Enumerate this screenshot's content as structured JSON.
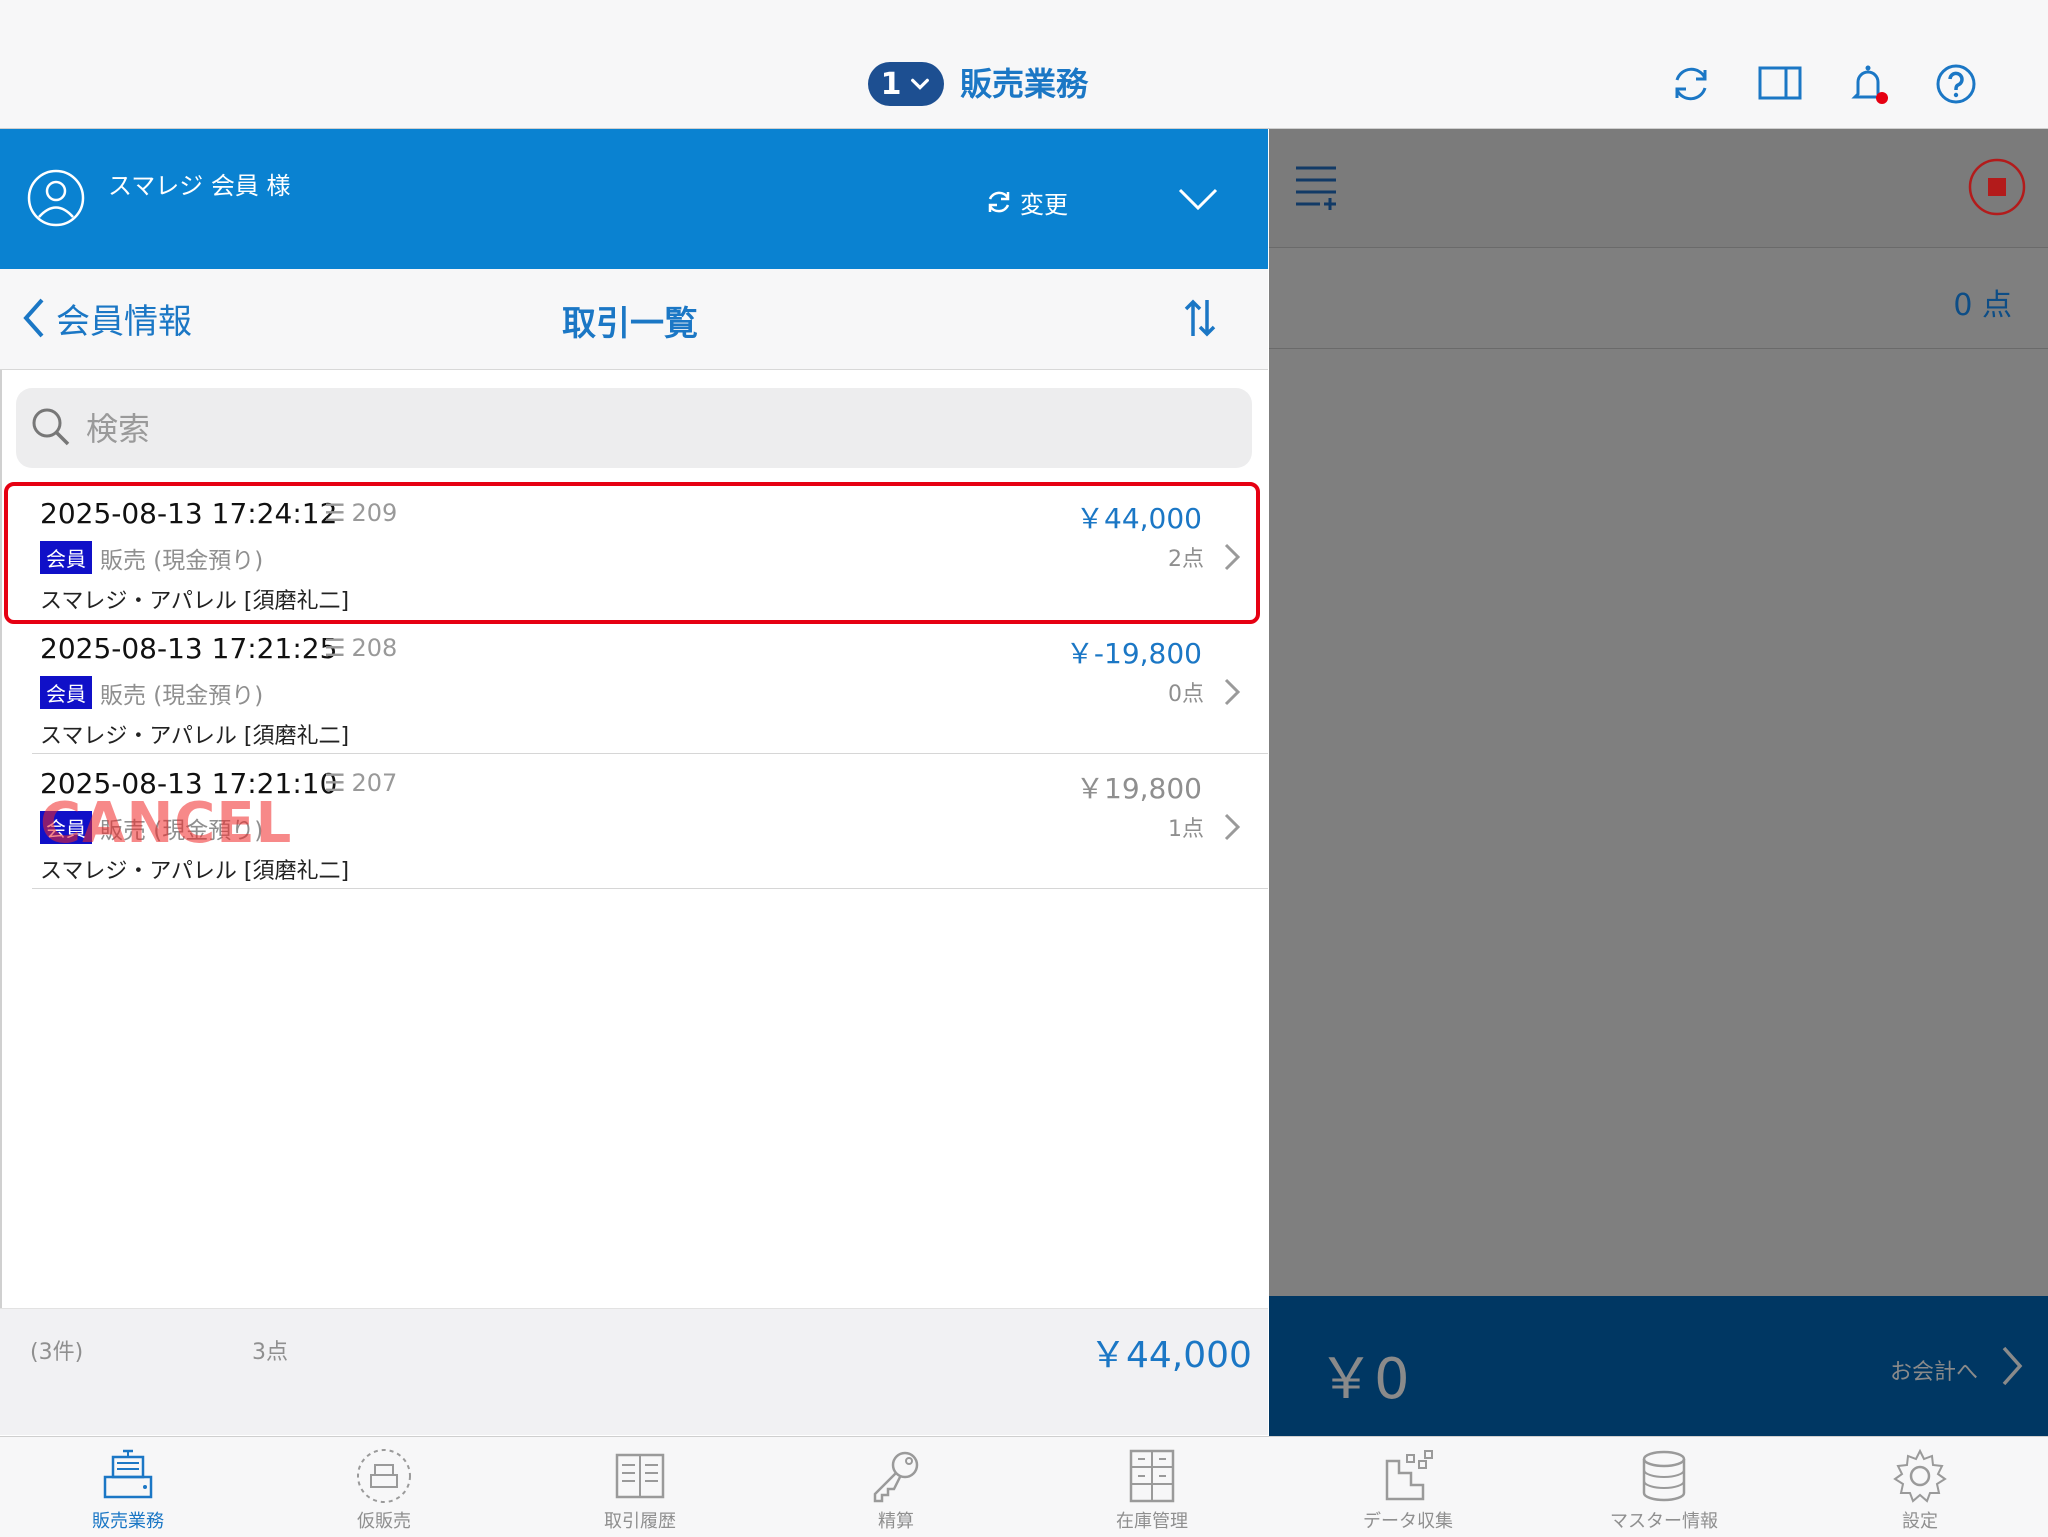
{
  "header": {
    "register_number": "1",
    "title": "販売業務",
    "icons": [
      "sync-icon",
      "split-view-icon",
      "bell-icon",
      "help-icon"
    ]
  },
  "member": {
    "name": "スマレジ 会員 様",
    "change_label": "変更"
  },
  "nav": {
    "back_label": "会員情報",
    "title": "取引一覧"
  },
  "search": {
    "placeholder": "検索"
  },
  "transactions": [
    {
      "datetime": "2025-08-13 17:24:12",
      "number": "209",
      "amount": "￥44,000",
      "badge": "会員",
      "kind": "販売 (現金預り)",
      "points": "2点",
      "staff": "スマレジ・アパレル [須磨礼二]",
      "highlighted": true,
      "cancelled": false
    },
    {
      "datetime": "2025-08-13 17:21:25",
      "number": "208",
      "amount": "￥-19,800",
      "badge": "会員",
      "kind": "販売 (現金預り)",
      "points": "0点",
      "staff": "スマレジ・アパレル [須磨礼二]",
      "highlighted": false,
      "cancelled": false
    },
    {
      "datetime": "2025-08-13 17:21:10",
      "number": "207",
      "amount": "￥19,800",
      "badge": "会員",
      "kind": "販売 (現金預り)",
      "points": "1点",
      "staff": "スマレジ・アパレル [須磨礼二]",
      "highlighted": false,
      "cancelled": true,
      "cancel_label": "CANCEL"
    }
  ],
  "summary": {
    "count": "(3件)",
    "points": "3点",
    "total": "￥44,000"
  },
  "cart": {
    "items_count": "0 点",
    "total": "￥0",
    "checkout_label": "お会計へ"
  },
  "tabs": [
    {
      "label": "販売業務",
      "icon": "register-icon",
      "active": true
    },
    {
      "label": "仮販売",
      "icon": "temp-sale-icon",
      "active": false
    },
    {
      "label": "取引履歴",
      "icon": "history-icon",
      "active": false
    },
    {
      "label": "精算",
      "icon": "key-icon",
      "active": false
    },
    {
      "label": "在庫管理",
      "icon": "inventory-icon",
      "active": false
    },
    {
      "label": "データ収集",
      "icon": "data-collect-icon",
      "active": false
    },
    {
      "label": "マスター情報",
      "icon": "database-icon",
      "active": false
    },
    {
      "label": "設定",
      "icon": "gear-icon",
      "active": false
    }
  ],
  "colors": {
    "accent": "#1b77c5",
    "member_bar": "#0a82d1",
    "pay_bar": "#003763",
    "highlight": "#e60012",
    "badge": "#1010c8"
  }
}
